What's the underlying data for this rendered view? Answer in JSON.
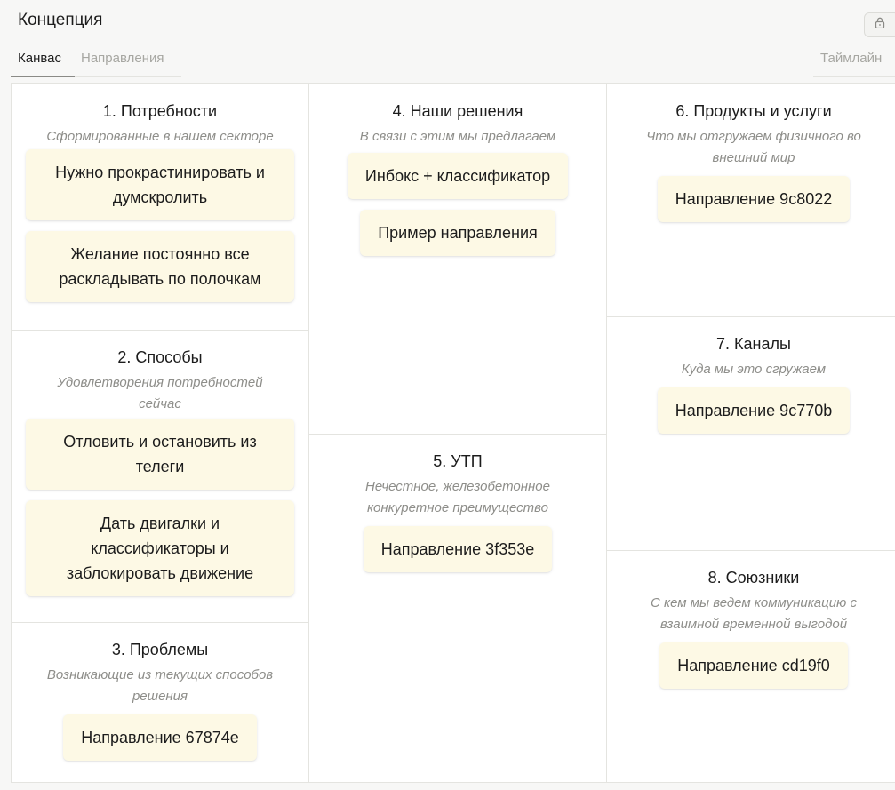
{
  "header": {
    "title": "Концепция",
    "tabs": [
      {
        "label": "Канвас",
        "active": true
      },
      {
        "label": "Направления",
        "active": false
      }
    ],
    "timeline_label": "Таймлайн",
    "lock_icon": "lock-icon"
  },
  "colors": {
    "card_background": "#fdf9e5",
    "subtitle": "#8e8e8a",
    "border": "#e4e4e0"
  },
  "sections": {
    "needs": {
      "title": "1. Потребности",
      "subtitle": "Сформированные в нашем секторе",
      "cards": [
        "Нужно прокрастинировать и думскролить",
        "Желание постоянно все раскладывать по полочкам"
      ]
    },
    "methods": {
      "title": "2. Способы",
      "subtitle": "Удовлетворения потребностей сейчас",
      "cards": [
        "Отловить и остановить из телеги",
        "Дать двигалки и классификаторы и заблокировать движение"
      ]
    },
    "problems": {
      "title": "3. Проблемы",
      "subtitle": "Возникающие из текущих способов решения",
      "cards": [
        "Направление 67874e"
      ]
    },
    "solutions": {
      "title": "4. Наши решения",
      "subtitle": "В связи с этим мы предлагаем",
      "cards": [
        "Инбокс + классификатор",
        "Пример направления"
      ]
    },
    "usp": {
      "title": "5. УТП",
      "subtitle": "Нечестное, железобетонное конкуретное преимущество",
      "cards": [
        "Направление 3f353e"
      ]
    },
    "products": {
      "title": "6. Продукты и услуги",
      "subtitle": "Что мы отгружаем физичного во внешний мир",
      "cards": [
        "Направление 9c8022"
      ]
    },
    "channels": {
      "title": "7. Каналы",
      "subtitle": "Куда мы это сгружаем",
      "cards": [
        "Направление 9c770b"
      ]
    },
    "allies": {
      "title": "8. Союзники",
      "subtitle": "С кем мы ведем коммуникацию с взаимной временной выгодой",
      "cards": [
        "Направление cd19f0"
      ]
    }
  }
}
